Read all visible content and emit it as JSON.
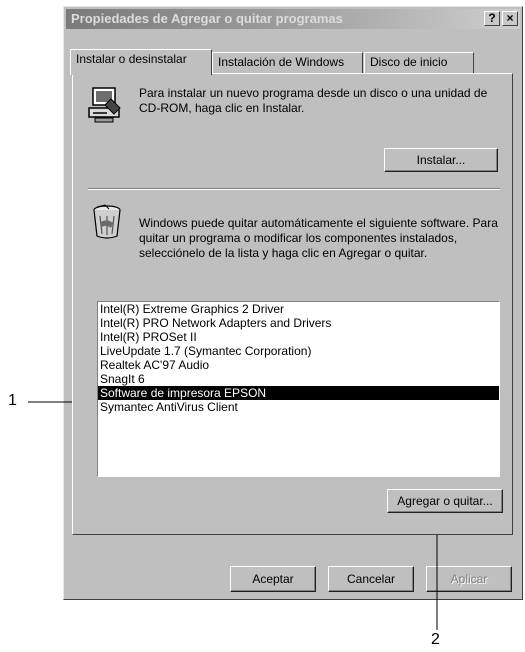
{
  "window": {
    "title": "Propiedades de Agregar o quitar programas",
    "help_label": "?",
    "close_label": "×"
  },
  "tabs": [
    {
      "label": "Instalar o desinstalar"
    },
    {
      "label": "Instalación de Windows"
    },
    {
      "label": "Disco de inicio"
    }
  ],
  "install_section": {
    "text": "Para instalar un nuevo programa desde un disco o una unidad de CD-ROM, haga clic en Instalar.",
    "install_button": "Instalar..."
  },
  "uninstall_section": {
    "text": "Windows puede quitar automáticamente el siguiente software. Para quitar un programa o modificar los componentes instalados, selecciónelo de la lista y haga clic en Agregar o quitar.",
    "programs": [
      "Intel(R) Extreme Graphics 2 Driver",
      "Intel(R) PRO Network Adapters and Drivers",
      "Intel(R) PROSet II",
      "LiveUpdate 1.7 (Symantec Corporation)",
      "Realtek AC'97 Audio",
      "SnagIt 6",
      "Software de impresora EPSON",
      "Symantec AntiVirus Client"
    ],
    "selected_program": "Software de impresora EPSON",
    "add_remove_button": "Agregar o quitar..."
  },
  "footer": {
    "ok_button": "Aceptar",
    "cancel_button": "Cancelar",
    "apply_button": "Aplicar"
  },
  "callouts": {
    "one": "1",
    "two": "2"
  }
}
